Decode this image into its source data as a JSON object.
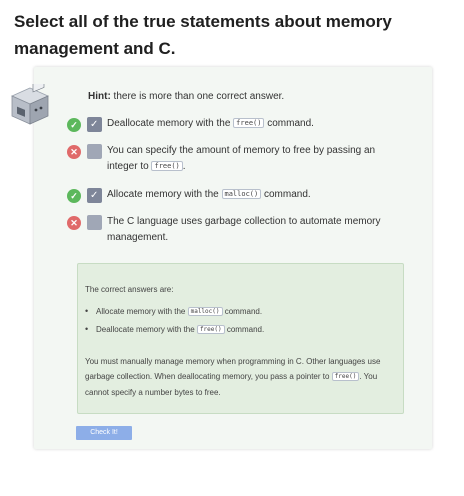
{
  "question": {
    "title": "Select all of the true statements about memory management and C."
  },
  "hint": {
    "label": "Hint:",
    "text": " there is more than one correct answer."
  },
  "options": [
    {
      "status": "correct",
      "checked": true,
      "before": "Deallocate memory with the ",
      "code": "free()",
      "after": " command."
    },
    {
      "status": "incorrect",
      "checked": false,
      "before": "You can specify the amount of memory to free by passing an integer to ",
      "code": "free()",
      "after": "."
    },
    {
      "status": "correct",
      "checked": true,
      "before": "Allocate memory with the ",
      "code": "malloc()",
      "after": " command."
    },
    {
      "status": "incorrect",
      "checked": false,
      "before": "The C language uses garbage collection to automate memory management.",
      "code": "",
      "after": ""
    }
  ],
  "icons": {
    "correct": "check-circle-icon",
    "incorrect": "x-circle-icon",
    "checkbox": "checkbox-icon",
    "mascot": "robot-mascot-icon"
  },
  "feedback": {
    "heading": "The correct answers are:",
    "answers": [
      {
        "before": "Allocate memory with the ",
        "code": "malloc()",
        "after": " command."
      },
      {
        "before": "Deallocate memory with the ",
        "code": "free()",
        "after": " command."
      }
    ],
    "explanation": {
      "part1": "You must manually manage memory when programming in C. Other languages use garbage collection. When deallocating memory, you pass a pointer to ",
      "code": "free()",
      "part2": ". You cannot specify a number bytes to free."
    }
  },
  "button": {
    "check_label": "Check It!"
  },
  "colors": {
    "card_bg": "#f3f7f3",
    "feedback_bg": "#e3eee0",
    "correct": "#5cb85c",
    "incorrect": "#e06a6a",
    "checkbox_checked": "#7e8699",
    "checkbox_unchecked": "#a0a7b6",
    "button": "#8daee8"
  }
}
